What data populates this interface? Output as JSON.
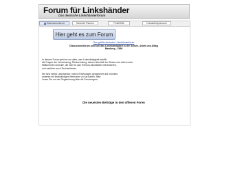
{
  "header": {
    "title": "Forum für Linkshänder",
    "subtitle": "Das deutsche Linkshänderforum"
  },
  "nav": {
    "items": [
      {
        "label": "Diskussionsforum",
        "active": true
      },
      {
        "label": "Neueste Themen"
      },
      {
        "label": "Profil/Hilfe"
      },
      {
        "label": "Kontakt/Impressum"
      }
    ]
  },
  "main": {
    "forum_button": "Hier geht es zum Forum",
    "small_link": "Das größte deutsche Linkshänderforum",
    "intro_line1": "Diskussionsforum rund um das Linkshändigkeit in der Schule, Arbeit und Alltag",
    "intro_line2": "Bamberg - 1996",
    "para1": [
      "In diesem Forum geht es um alles, was Linkshändigkeit betrifft,",
      "die Fragen der Umschulung, Rückschulung, seinen Nachteil der Wesen und vieles mehr.",
      "Willkommen sind alle, die sich für das Thema Linkshänder interessieren,",
      "und natürlich auch Rechtshänder."
    ],
    "para2": [
      "Wir sind selbst Linkshänder, haben Erfahrungen gesammelt und möchten",
      "anderen mit linkshändigen Menschen zu tun haben. Bitte",
      "Lesen Sie vor der Registrierung bitte die Forumregeln."
    ],
    "latest_heading": "Die neuesten Beiträge in den offenen Foren"
  }
}
